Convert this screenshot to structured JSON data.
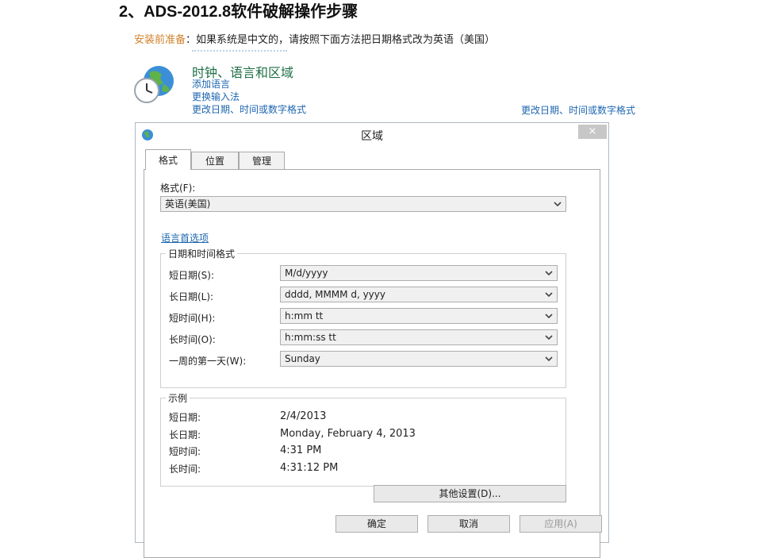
{
  "doc": {
    "heading": "2、ADS-2012.8软件破解操作步骤",
    "note_prefix": "安装前准备",
    "note_text": "：如果系统是中文的，请按照下面方法把日期格式改为英语（美国）"
  },
  "control_panel": {
    "title": "时钟、语言和区域",
    "links": [
      "添加语言",
      "更换输入法",
      "更改日期、时间或数字格式"
    ],
    "right_link": "更改日期、时间或数字格式"
  },
  "dialog": {
    "title": "区域",
    "close": "×",
    "tabs": [
      "格式",
      "位置",
      "管理"
    ],
    "format_label": "格式(F):",
    "format_value": "英语(美国)",
    "language_pref_link": "语言首选项",
    "datetime_group_title": "日期和时间格式",
    "datetime_rows": [
      {
        "label": "短日期(S):",
        "value": "M/d/yyyy"
      },
      {
        "label": "长日期(L):",
        "value": "dddd, MMMM d, yyyy"
      },
      {
        "label": "短时间(H):",
        "value": "h:mm tt"
      },
      {
        "label": "长时间(O):",
        "value": "h:mm:ss tt"
      },
      {
        "label": "一周的第一天(W):",
        "value": "Sunday"
      }
    ],
    "example_group_title": "示例",
    "examples": [
      {
        "label": "短日期:",
        "value": "2/4/2013"
      },
      {
        "label": "长日期:",
        "value": "Monday, February 4, 2013"
      },
      {
        "label": "短时间:",
        "value": "4:31 PM"
      },
      {
        "label": "长时间:",
        "value": "4:31:12 PM"
      }
    ],
    "other_settings_button": "其他设置(D)...",
    "ok_button": "确定",
    "cancel_button": "取消",
    "apply_button": "应用(A)"
  },
  "colors": {
    "link": "#1e66b0",
    "note_prefix": "#d0822a",
    "cp_title": "#1e6f45"
  },
  "icons": {
    "control_panel": "globe-clock-icon",
    "dialog": "globe-icon",
    "dropdown": "chevron-down-icon"
  }
}
